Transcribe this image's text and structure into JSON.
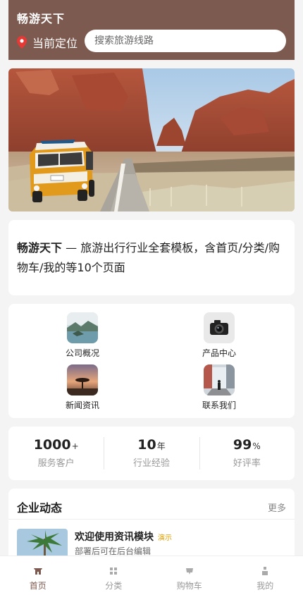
{
  "header": {
    "title": "畅游天下",
    "location_label": "当前定位",
    "search_placeholder": "搜索旅游线路"
  },
  "intro": {
    "brand": "畅游天下",
    "text": " — 旅游出行行业全套模板，含首页/分类/购物车/我的等10个页面"
  },
  "grid": [
    {
      "label": "公司概况",
      "icon": "lake-photo-icon"
    },
    {
      "label": "产品中心",
      "icon": "camera-icon"
    },
    {
      "label": "新闻资讯",
      "icon": "sunset-tree-icon"
    },
    {
      "label": "联系我们",
      "icon": "street-photo-icon"
    }
  ],
  "stats": [
    {
      "value": "1000",
      "unit": "+",
      "label": "服务客户"
    },
    {
      "value": "10",
      "unit": "年",
      "label": "行业经验"
    },
    {
      "value": "99",
      "unit": "%",
      "label": "好评率"
    }
  ],
  "news": {
    "title": "企业动态",
    "more": "更多",
    "items": [
      {
        "title": "欢迎使用资讯模块",
        "tag": "演示",
        "sub": "部署后可在后台编辑"
      }
    ]
  },
  "tabbar": [
    {
      "label": "首页",
      "icon": "home-icon",
      "active": true
    },
    {
      "label": "分类",
      "icon": "grid-icon",
      "active": false
    },
    {
      "label": "购物车",
      "icon": "cart-icon",
      "active": false
    },
    {
      "label": "我的",
      "icon": "user-icon",
      "active": false
    }
  ],
  "colors": {
    "brand": "#7d5a4f",
    "tag": "#e0a000"
  }
}
